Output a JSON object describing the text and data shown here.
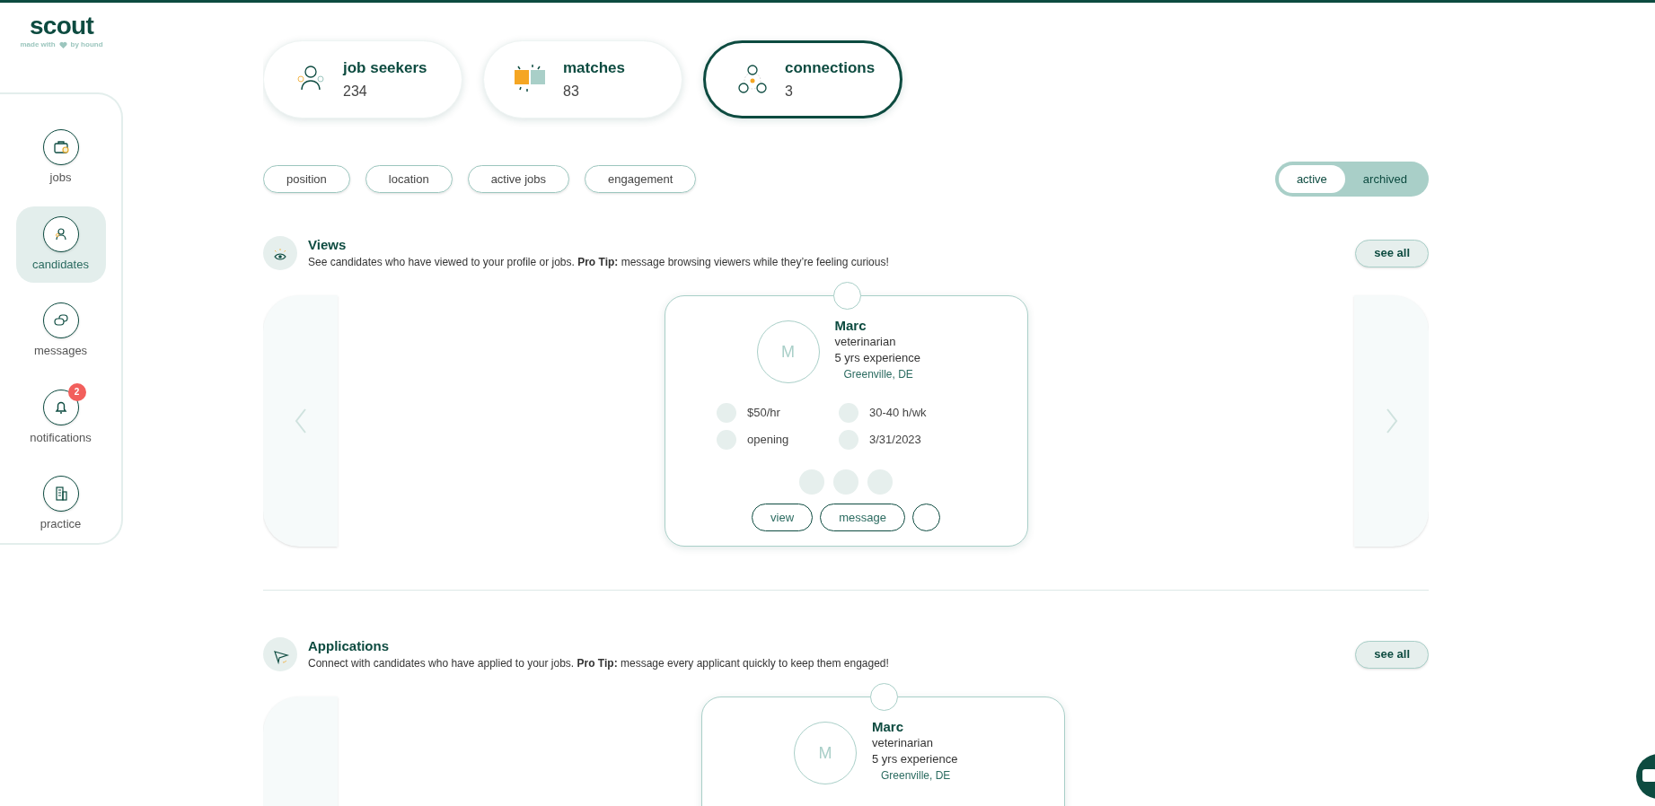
{
  "brand": {
    "name": "scout",
    "tagline_before": "made with",
    "tagline_after": "by hound"
  },
  "sidebar": {
    "items": [
      {
        "label": "jobs",
        "selected": false
      },
      {
        "label": "candidates",
        "selected": true
      },
      {
        "label": "messages",
        "selected": false
      },
      {
        "label": "notifications",
        "selected": false,
        "badge": "2"
      },
      {
        "label": "practice",
        "selected": false
      }
    ]
  },
  "stats": [
    {
      "label": "job seekers",
      "count": "234",
      "selected": false
    },
    {
      "label": "matches",
      "count": "83",
      "selected": false
    },
    {
      "label": "connections",
      "count": "3",
      "selected": true
    }
  ],
  "filters": [
    "position",
    "location",
    "active jobs",
    "engagement"
  ],
  "status_toggle": [
    {
      "label": "active",
      "selected": true
    },
    {
      "label": "archived",
      "selected": false
    }
  ],
  "sections": [
    {
      "title": "Views",
      "description": "See candidates who have viewed to your profile or jobs. **Pro Tip:** message browsing viewers while they’re feeling curious!",
      "see_all": "see all",
      "candidate": {
        "initial": "M",
        "name": "Marc",
        "role": "veterinarian",
        "experience": "5 yrs experience",
        "location": "Greenville, DE",
        "details": [
          "$50/hr",
          "30-40 h/wk",
          "opening",
          "3/31/2023"
        ],
        "actions": [
          "view",
          "message"
        ]
      }
    },
    {
      "title": "Applications",
      "description": "Connect with candidates who have applied to your jobs. **Pro Tip:** message every applicant quickly to keep them engaged!",
      "see_all": "see all",
      "candidate": {
        "initial": "M",
        "name": "Marc",
        "role": "veterinarian",
        "experience": "5 yrs experience",
        "location": "Greenville, DE"
      }
    }
  ]
}
